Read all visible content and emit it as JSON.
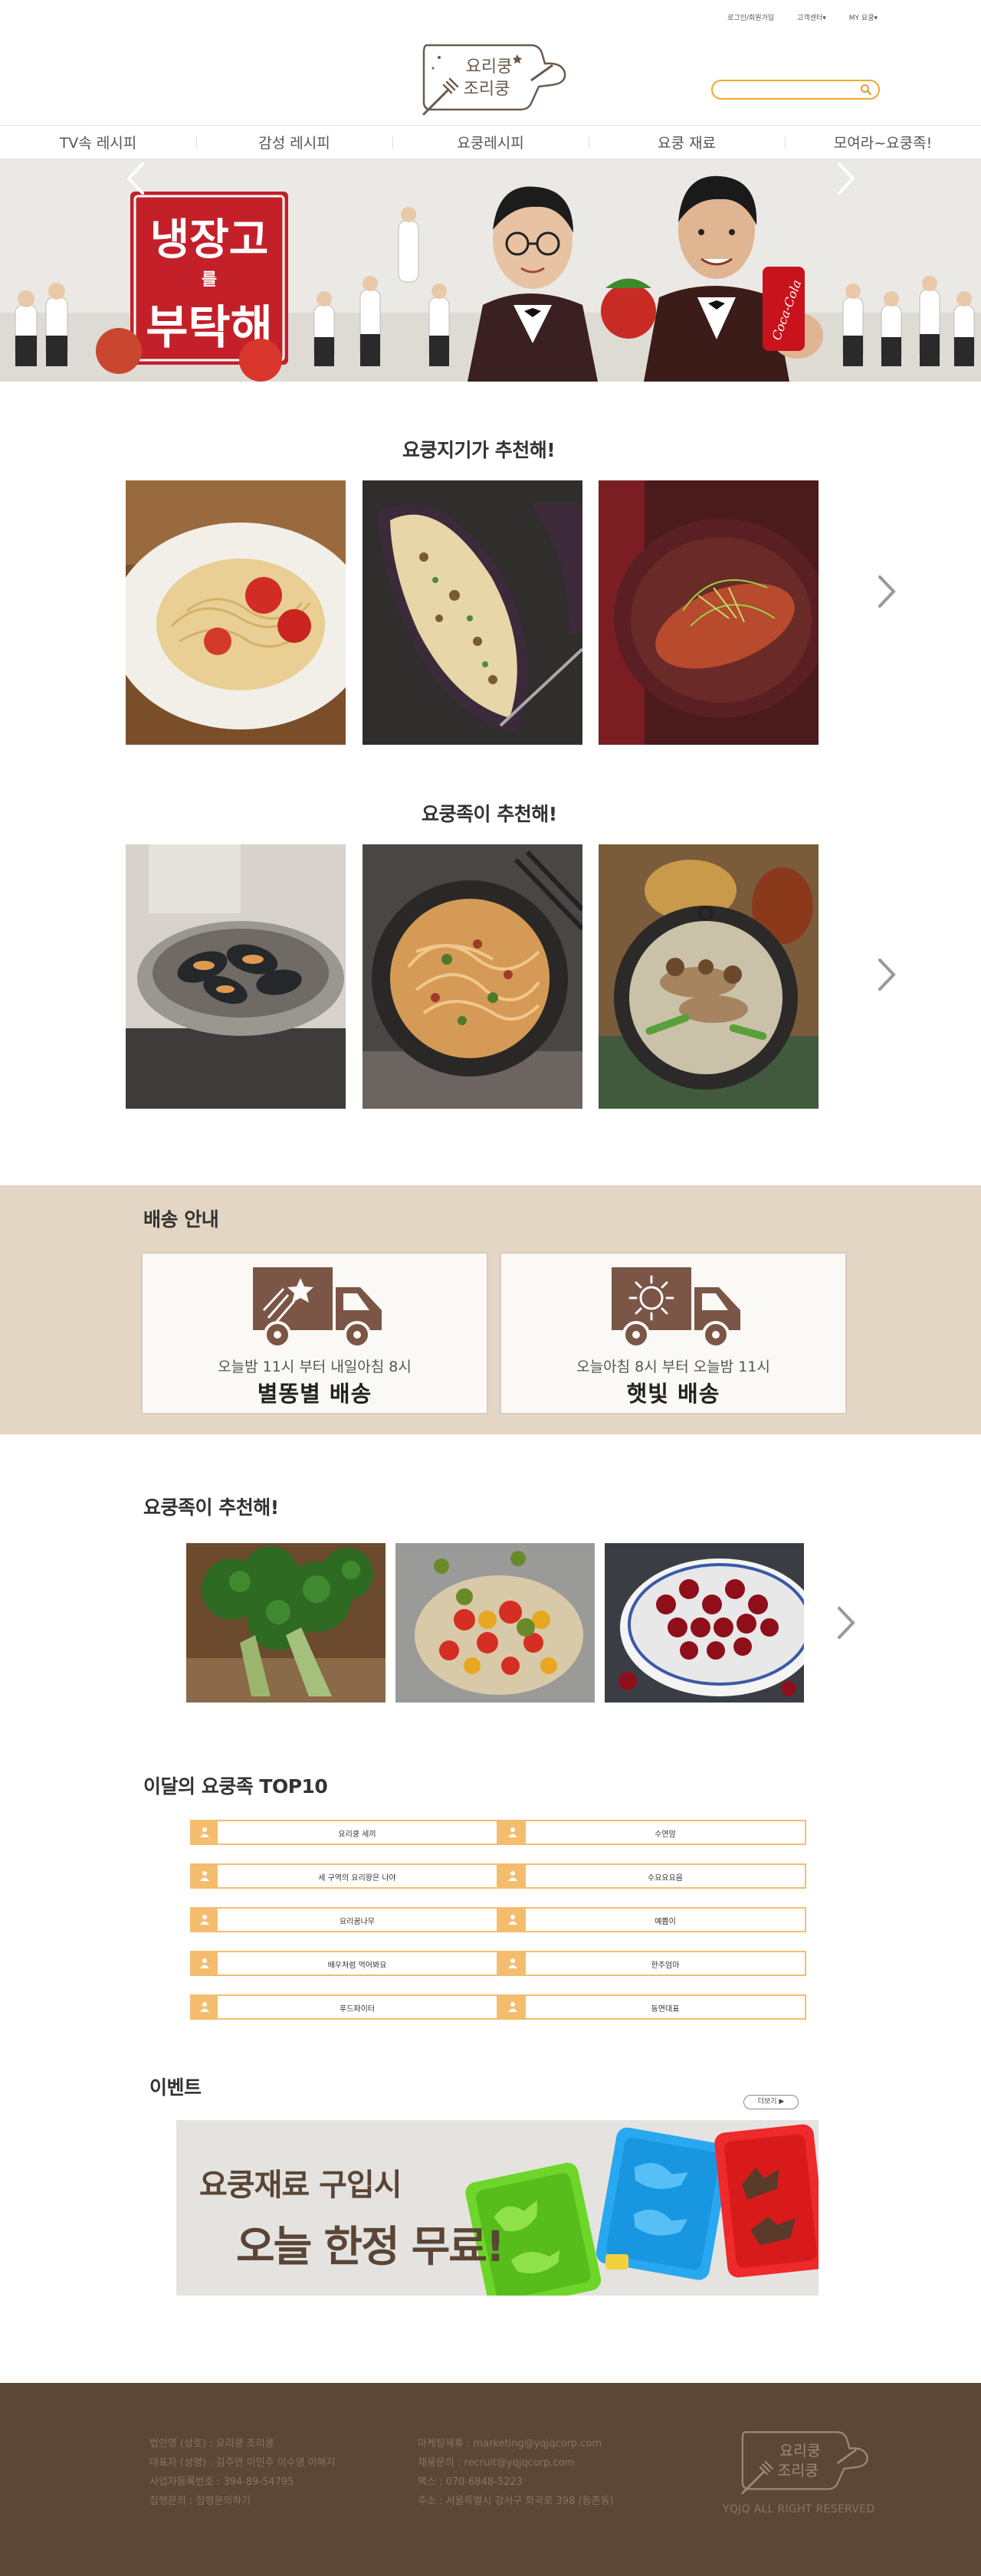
{
  "header": {
    "top_links": [
      "로그인/회원가입",
      "고객센터▾",
      "MY 요쿵▾"
    ],
    "logo_text_1": "요리쿵",
    "logo_text_2": "조리쿵",
    "search_placeholder": ""
  },
  "nav": {
    "items": [
      "TV속 레시피",
      "감성 레시피",
      "요쿵레시피",
      "요쿵 재료",
      "모여라~요쿵족!"
    ]
  },
  "hero": {
    "title_top": "냉장고",
    "title_mid": "를",
    "title_bottom": "부탁해",
    "can_text": "Coca-Cola"
  },
  "section1": {
    "title": "요쿵지기가 추천해!"
  },
  "section2": {
    "title": "요쿵족이 추천해!"
  },
  "delivery": {
    "title": "배송 안내",
    "cards": [
      {
        "sub": "오늘밤 11시 부터 내일아침 8시",
        "main": "별똥별 배송",
        "icon": "truck-star-icon"
      },
      {
        "sub": "오늘아침 8시 부터 오늘밤 11시",
        "main": "햇빛 배송",
        "icon": "truck-sun-icon"
      }
    ]
  },
  "section3": {
    "title": "요쿵족이 추천해!"
  },
  "top10": {
    "title": "이달의 요쿵족 TOP10",
    "items": [
      "요리쿵 세끼",
      "수연맘",
      "세 구역의 요리왕은 나야",
      "수요요요음",
      "요리꿈나무",
      "예쁨이",
      "배우처럼 먹어봐요",
      "한주엄마",
      "푸드파이터",
      "동연대표"
    ]
  },
  "event": {
    "title": "이벤트",
    "more": "더보기 ▶",
    "line1": "요쿵재료 구입시",
    "line2": "오늘 한정 무료!"
  },
  "footer": {
    "col1": [
      "법인명 (상호) : 요리쿵 조리쿵",
      "대표자 (성명) : 김주연 이민주 이수영 이해지",
      "사업자등록번호 : 394-89-54795",
      "집행문의 : 집행문의하기"
    ],
    "col2": [
      "마케팅제휴 : marketing@yqjqcorp.com",
      "채용문의 : recruit@yqjqcorp.com",
      "팩스 : 070-6848-5223",
      "주소 :  서울특별시 강서구 화곡로 398 (등촌동)"
    ],
    "logo_text_1": "요리쿵",
    "logo_text_2": "조리쿵",
    "copyright": "YQJQ ALL RIGHT RESERVED"
  }
}
